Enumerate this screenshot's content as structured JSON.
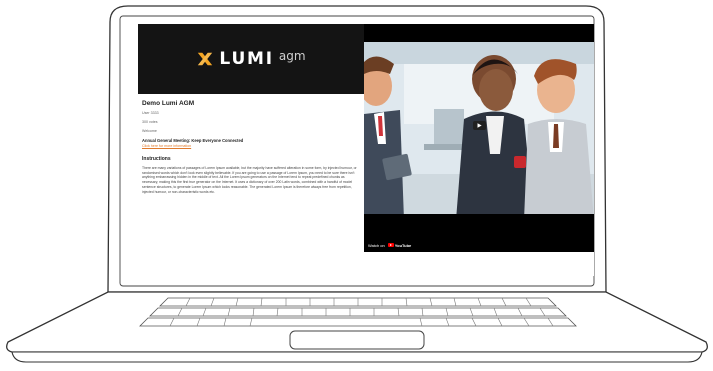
{
  "logo": {
    "word": "LUMI",
    "sub": "agm",
    "accent": "#f5a623"
  },
  "meeting": {
    "title": "Demo Lumi AGM",
    "user": "User 3333",
    "votes": "300 votes",
    "welcome": "Welcome",
    "subtitle": "Annual General Meeting: Keep Everyone Connected",
    "link": "Click here for more information"
  },
  "instructions": {
    "heading": "Instructions",
    "body": "There are many variations of passages of Lorem Ipsum available, but the majority have suffered alteration in some form, by injected humour, or randomised words which don't look even slightly believable. If you are going to use a passage of Lorem Ipsum, you need to be sure there isn't anything embarrassing hidden in the middle of text. All the Lorem Ipsum generators on the Internet tend to repeat predefined chunks as necessary, making this the first true generator on the Internet. It uses a dictionary of over 200 Latin words, combined with a handful of model sentence structures, to generate Lorem Ipsum which looks reasonable. The generated Lorem Ipsum is therefore always free from repetition, injected humour, or non-characteristic words etc."
  },
  "video": {
    "watch_on": "Watch on",
    "platform": "YouTube",
    "play_icon": "play-icon"
  },
  "colors": {
    "banner": "#141414",
    "link": "#e07a2c",
    "video_bg": "#000000"
  }
}
